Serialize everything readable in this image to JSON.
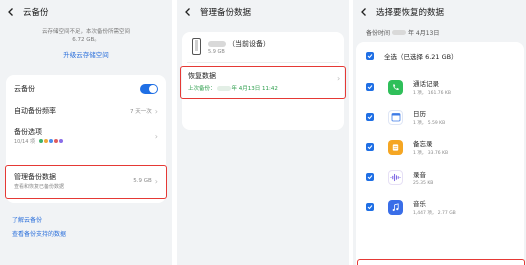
{
  "panel1": {
    "title": "云备份",
    "info_line1": "云存储空间不足，本次备份所需空间",
    "info_line2": "6.72 GB。",
    "upgrade_link": "升级云存储空间",
    "rows": {
      "cloud_backup": "云备份",
      "backup_freq": "自动备份频率",
      "backup_freq_value": "7 天一次",
      "backup_options": "备份选项",
      "backup_options_sub": "10/14 项",
      "manage": "管理备份数据",
      "manage_sub": "查看和恢复已备份数据",
      "manage_value": "5.9 GB"
    },
    "links": {
      "learn": "了解云备份",
      "supported": "查看备份支持的数据"
    },
    "dot_colors": [
      "#3fb36b",
      "#f0a83a",
      "#4a8cf0",
      "#e05d5d",
      "#8a6de8"
    ]
  },
  "panel2": {
    "title": "管理备份数据",
    "device_name": "（当前设备）",
    "device_size": "5.9 GB",
    "restore_title": "恢复数据",
    "restore_sub_prefix": "上次备份：",
    "restore_sub_date": "年 4月13日 11:42"
  },
  "panel3": {
    "title": "选择要恢复的数据",
    "date_prefix": "备份时间",
    "date_suffix": "年 4月13日",
    "select_all": "全选（已选择 6.21 GB）",
    "items": [
      {
        "name": "通话记录",
        "meta": "1 项，      161.76 KB",
        "icon": "phone-icon"
      },
      {
        "name": "日历",
        "meta": "1 项，      5.59 KB",
        "icon": "calendar-icon"
      },
      {
        "name": "备忘录",
        "meta": "1 项，      33.76 KB",
        "icon": "notes-icon"
      },
      {
        "name": "录音",
        "meta": "25.35 KB",
        "icon": "recorder-icon"
      },
      {
        "name": "音乐",
        "meta": "1,447 项，      2.77 GB",
        "icon": "music-icon"
      }
    ]
  },
  "colors": {
    "accent": "#1f6fe5",
    "highlight_border": "#e53935",
    "link_blue": "#2a6fdb",
    "green_text": "#2a9d4a"
  }
}
